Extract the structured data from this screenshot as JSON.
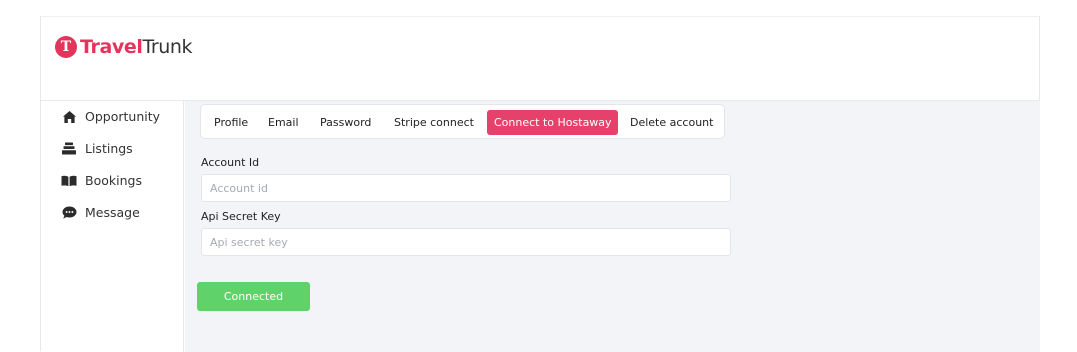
{
  "brand": {
    "name_part1": "Travel",
    "name_part2": "Trunk",
    "mark": "T",
    "accent_color": "#e5345c"
  },
  "sidebar": {
    "items": [
      {
        "label": "Opportunity",
        "icon": "home-icon"
      },
      {
        "label": "Listings",
        "icon": "layers-icon"
      },
      {
        "label": "Bookings",
        "icon": "book-icon"
      },
      {
        "label": "Message",
        "icon": "chat-bubble-icon"
      }
    ]
  },
  "tabs": [
    {
      "label": "Profile",
      "active": false
    },
    {
      "label": "Email",
      "active": false
    },
    {
      "label": "Password",
      "active": false
    },
    {
      "label": "Stripe connect",
      "active": false
    },
    {
      "label": "Connect to Hostaway",
      "active": true
    },
    {
      "label": "Delete account",
      "active": false
    }
  ],
  "form": {
    "account_id": {
      "label": "Account Id",
      "value": "",
      "placeholder": "Account id"
    },
    "api_secret_key": {
      "label": "Api Secret Key",
      "value": "",
      "placeholder": "Api secret key"
    },
    "submit_label": "Connected",
    "submit_color": "#5fd36a"
  }
}
